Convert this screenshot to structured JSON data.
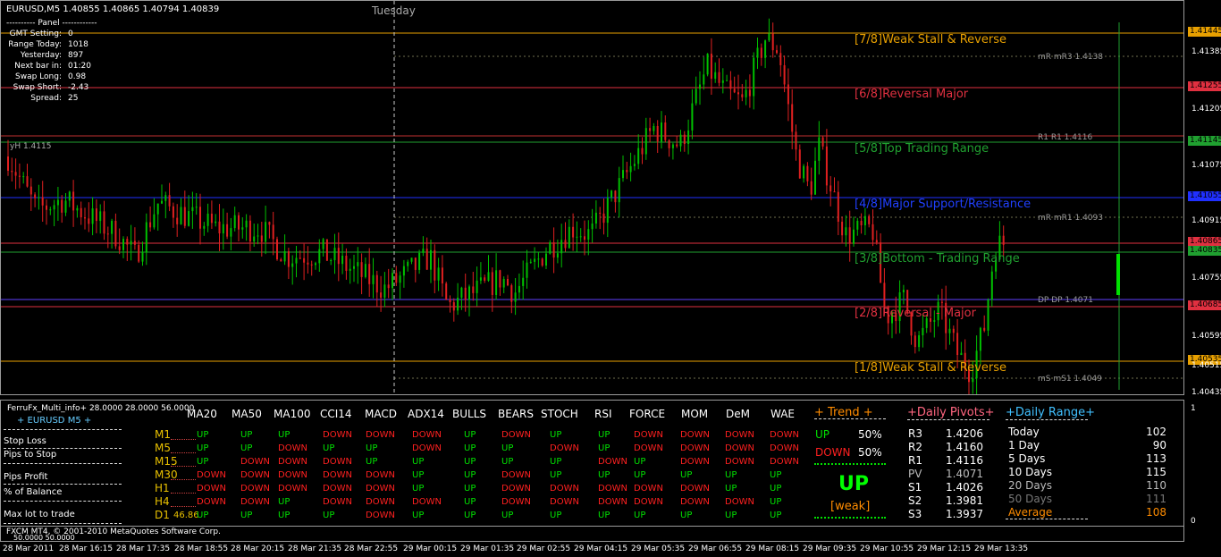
{
  "chart": {
    "symbol": "EURUSD,M5",
    "ohlc": "1.40855 1.40865 1.40794 1.40839",
    "day_label": "Tuesday",
    "yh_label": "yH 1.4115",
    "price_ticks": [
      "1.41445",
      "1.41385",
      "1.41255",
      "1.41205",
      "1.41145",
      "1.41075",
      "1.41055",
      "1.40915",
      "1.40865",
      "1.40835",
      "1.40755",
      "1.40685",
      "1.40595",
      "1.40535",
      "1.40515",
      "1.40435"
    ],
    "price_tags": [
      {
        "label": "1.41445",
        "color": "#e8a000"
      },
      {
        "label": "1.41255",
        "color": "#e03040"
      },
      {
        "label": "1.41145",
        "color": "#20a030"
      },
      {
        "label": "1.41055",
        "color": "#2030ff"
      },
      {
        "label": "1.40865",
        "color": "#e03040"
      },
      {
        "label": "1.40835",
        "color": "#20a030"
      },
      {
        "label": "1.40685",
        "color": "#e03040"
      },
      {
        "label": "1.40535",
        "color": "#e8a000"
      }
    ],
    "plain_ticks": [
      "1.41385",
      "1.41205",
      "1.41075",
      "1.40915",
      "1.40755",
      "1.40595",
      "1.40515",
      "1.40435"
    ],
    "murrey": [
      {
        "label": "[7/8]Weak Stall & Reverse",
        "color": "#e8a000"
      },
      {
        "label": "[6/8]Reversal Major",
        "color": "#e03040"
      },
      {
        "label": "[5/8]Top Trading Range",
        "color": "#20a030"
      },
      {
        "label": "[4/8]Major Support/Resistance",
        "color": "#2040ff"
      },
      {
        "label": "[3/8]Bottom - Trading Range",
        "color": "#20a030"
      },
      {
        "label": "[2/8]Reversal - Major",
        "color": "#e03040"
      },
      {
        "label": "[1/8]Weak Stall & Reverse",
        "color": "#e8a000"
      }
    ],
    "pivot_line_labels": [
      "mR mR3 1.4138",
      "R1 R1 1.4116",
      "mR mR1 1.4093",
      "DP DP 1.4071",
      "mS mS1 1.4049"
    ],
    "time_ticks": [
      "28 Mar 2011",
      "28 Mar 16:15",
      "28 Mar 17:35",
      "28 Mar 18:55",
      "28 Mar 20:15",
      "28 Mar 21:35",
      "28 Mar 22:55",
      "29 Mar 00:15",
      "29 Mar 01:35",
      "29 Mar 02:55",
      "29 Mar 04:15",
      "29 Mar 05:35",
      "29 Mar 06:55",
      "29 Mar 08:15",
      "29 Mar 09:35",
      "29 Mar 10:55",
      "29 Mar 12:15",
      "29 Mar 13:35"
    ]
  },
  "panel": {
    "title": "---------- Panel ------------",
    "rows": [
      {
        "k": "GMT Setting:",
        "v": "0"
      },
      {
        "k": "Range Today:",
        "v": "1018"
      },
      {
        "k": "Yesterday:",
        "v": "897"
      },
      {
        "k": "Next bar in:",
        "v": "01:20"
      },
      {
        "k": "Swap Long:",
        "v": "0.98"
      },
      {
        "k": "Swap Short:",
        "v": "-2.43"
      },
      {
        "k": "Spread:",
        "v": "25"
      }
    ]
  },
  "indicator": {
    "name": "FerruFx_Multi_info+ 28.0000 28.0000 56.0000",
    "pair_label": "+ EURUSD M5 +",
    "left_labels": [
      "Stop Loss",
      "Pips to Stop",
      "Pips Profit",
      "% of Balance",
      "Max lot to trade"
    ],
    "columns": [
      "MA20",
      "MA50",
      "MA100",
      "CCI14",
      "MACD",
      "ADX14",
      "BULLS",
      "BEARS",
      "STOCH",
      "RSI",
      "FORCE",
      "MOM",
      "DeM",
      "WAE"
    ],
    "timeframes": [
      "M1",
      "M5",
      "M15",
      "M30",
      "H1",
      "H4",
      "D1"
    ],
    "d1_value": "46.86",
    "grid": [
      [
        "UP",
        "UP",
        "UP",
        "DOWN",
        "DOWN",
        "DOWN",
        "UP",
        "DOWN",
        "UP",
        "UP",
        "DOWN",
        "DOWN",
        "DOWN",
        "DOWN"
      ],
      [
        "UP",
        "UP",
        "DOWN",
        "UP",
        "UP",
        "DOWN",
        "UP",
        "UP",
        "DOWN",
        "UP",
        "DOWN",
        "DOWN",
        "DOWN",
        "DOWN"
      ],
      [
        "UP",
        "DOWN",
        "DOWN",
        "DOWN",
        "UP",
        "UP",
        "UP",
        "UP",
        "UP",
        "DOWN",
        "UP",
        "DOWN",
        "DOWN",
        "DOWN"
      ],
      [
        "DOWN",
        "DOWN",
        "DOWN",
        "DOWN",
        "DOWN",
        "UP",
        "UP",
        "DOWN",
        "UP",
        "UP",
        "UP",
        "UP",
        "UP",
        "UP"
      ],
      [
        "DOWN",
        "DOWN",
        "DOWN",
        "DOWN",
        "DOWN",
        "UP",
        "UP",
        "DOWN",
        "DOWN",
        "DOWN",
        "DOWN",
        "DOWN",
        "UP",
        "UP"
      ],
      [
        "DOWN",
        "DOWN",
        "UP",
        "DOWN",
        "DOWN",
        "DOWN",
        "UP",
        "DOWN",
        "DOWN",
        "DOWN",
        "DOWN",
        "DOWN",
        "DOWN",
        "UP"
      ],
      [
        "UP",
        "UP",
        "UP",
        "UP",
        "DOWN",
        "UP",
        "UP",
        "UP",
        "UP",
        "UP",
        "UP",
        "UP",
        "UP",
        "UP"
      ]
    ],
    "trend": {
      "title": "+ Trend +",
      "up_label": "UP",
      "up_pct": "50%",
      "down_label": "DOWN",
      "down_pct": "50%",
      "big": "UP",
      "strength": "[weak]"
    },
    "pivots": {
      "title": "+Daily Pivots+",
      "rows": [
        {
          "k": "R3",
          "v": "1.4206"
        },
        {
          "k": "R2",
          "v": "1.4160"
        },
        {
          "k": "R1",
          "v": "1.4116"
        },
        {
          "k": "PV",
          "v": "1.4071"
        },
        {
          "k": "S1",
          "v": "1.4026"
        },
        {
          "k": "S2",
          "v": "1.3981"
        },
        {
          "k": "S3",
          "v": "1.3937"
        }
      ]
    },
    "range": {
      "title": "+Daily Range+",
      "rows": [
        {
          "k": "Today",
          "v": "102"
        },
        {
          "k": "1 Day",
          "v": "90"
        },
        {
          "k": "5 Days",
          "v": "113"
        },
        {
          "k": "10 Days",
          "v": "115"
        },
        {
          "k": "20 Days",
          "v": "110"
        },
        {
          "k": "50 Days",
          "v": "111"
        },
        {
          "k": "Average",
          "v": "108"
        }
      ]
    },
    "scale_top": "1",
    "scale_bottom": "0",
    "footer_scale": "50.0000 50.0000",
    "copyright": "FXCM MT4, © 2001-2010 MetaQuotes Software Corp."
  },
  "colors": {
    "up": "#00e000",
    "down": "#ff2020",
    "bull_candle": "#00c000",
    "bear_candle": "#e02020"
  }
}
